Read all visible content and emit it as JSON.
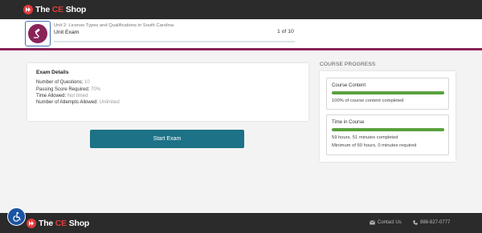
{
  "header": {
    "logo": {
      "prefix": "The ",
      "highlight": "CE",
      "suffix": " Shop"
    }
  },
  "unit": {
    "subtitle": "Unit 2: License Types and Qualifications in South Carolina",
    "title": "Unit Exam",
    "counter": "1 of 10",
    "icon": "gavel-icon"
  },
  "exam": {
    "heading": "Exam Details",
    "rows": [
      {
        "label": "Number of Questions:",
        "value": "10"
      },
      {
        "label": "Passing Score Required:",
        "value": "70%"
      },
      {
        "label": "Time Allowed:",
        "value": "Not timed"
      },
      {
        "label": "Number of Attempts Allowed:",
        "value": "Unlimited"
      }
    ],
    "start_label": "Start Exam"
  },
  "progress": {
    "heading": "COURSE PROGRESS",
    "content": {
      "label": "Course Content",
      "fraction": 1.0,
      "text": "100% of course content completed"
    },
    "time": {
      "label": "Time in Course",
      "fraction": 1.0,
      "text": "59 hours, 51 minutes completed",
      "minimum": "Minimum of 50 hours, 0 minutes required"
    }
  },
  "footer": {
    "logo": {
      "prefix": "The ",
      "highlight": "CE",
      "suffix": " Shop"
    },
    "contact_label": "Contact Us",
    "phone": "888-827-0777"
  },
  "colors": {
    "brand_red": "#e23b3b",
    "accent_purple": "#8a2357",
    "button_teal": "#1d7287",
    "progress_green": "#5aa13e"
  }
}
